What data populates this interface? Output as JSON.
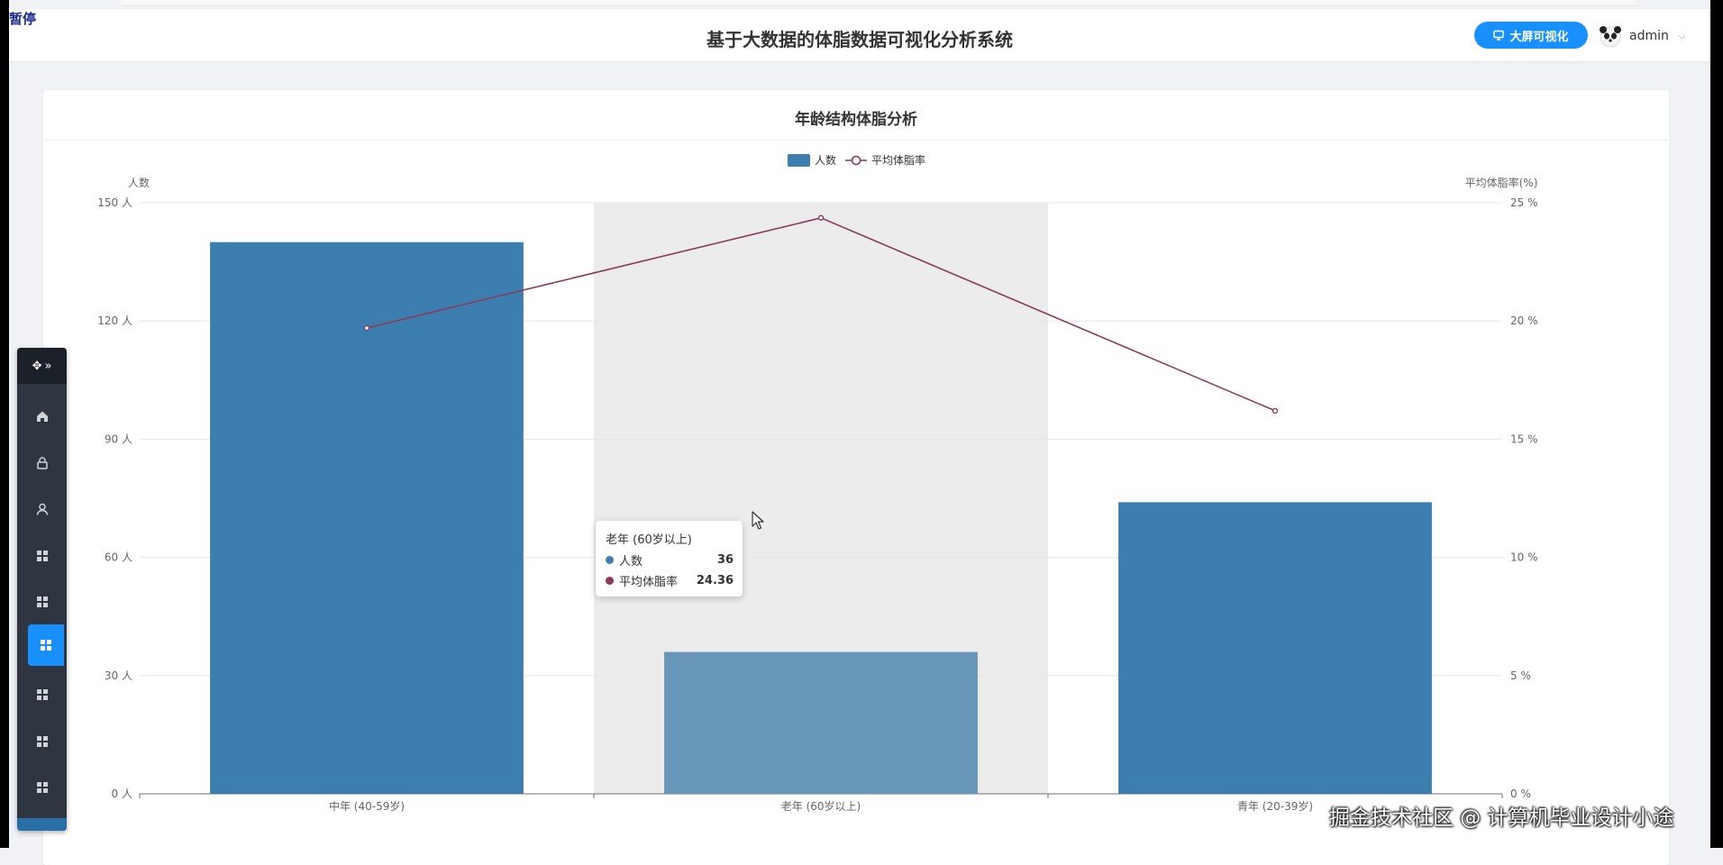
{
  "overlay": {
    "pause_label": "暂停"
  },
  "header": {
    "title": "基于大数据的体脂数据可视化分析系统",
    "big_screen_button": "大屏可视化",
    "user_name": "admin"
  },
  "card": {
    "title": "年龄结构体脂分析"
  },
  "chart_data": {
    "type": "bar",
    "title": "",
    "categories": [
      "中年 (40-59岁)",
      "老年 (60岁以上)",
      "青年 (20-39岁)"
    ],
    "series": [
      {
        "name": "人数",
        "type": "bar",
        "values": [
          140,
          36,
          74
        ],
        "color": "#3c7eaf",
        "axis": "left"
      },
      {
        "name": "平均体脂率",
        "type": "line",
        "values": [
          19.7,
          24.36,
          16.2
        ],
        "color": "#8b3a5a",
        "axis": "right"
      }
    ],
    "y_left": {
      "label": "人数",
      "min": 0,
      "max": 150,
      "interval": 30,
      "unit": " 人"
    },
    "y_right": {
      "label": "平均体脂率(%)",
      "min": 0,
      "max": 25,
      "interval": 5,
      "unit": " %"
    },
    "legend": "top-center",
    "grid": true,
    "highlighted_category": "老年 (60岁以上)"
  },
  "tooltip": {
    "title": "老年 (60岁以上)",
    "rows": [
      {
        "label": "人数",
        "value": "36",
        "color": "#3c7eaf"
      },
      {
        "label": "平均体脂率",
        "value": "24.36",
        "color": "#8b3a5a"
      }
    ]
  },
  "float_toolbar": {
    "items": [
      "home-icon",
      "lock-icon",
      "user-icon",
      "grid-icon",
      "grid-icon",
      "grid-icon",
      "grid-icon",
      "grid-icon",
      "grid-icon"
    ],
    "active_index": 5
  },
  "watermark": "掘金技术社区 @ 计算机毕业设计小途"
}
